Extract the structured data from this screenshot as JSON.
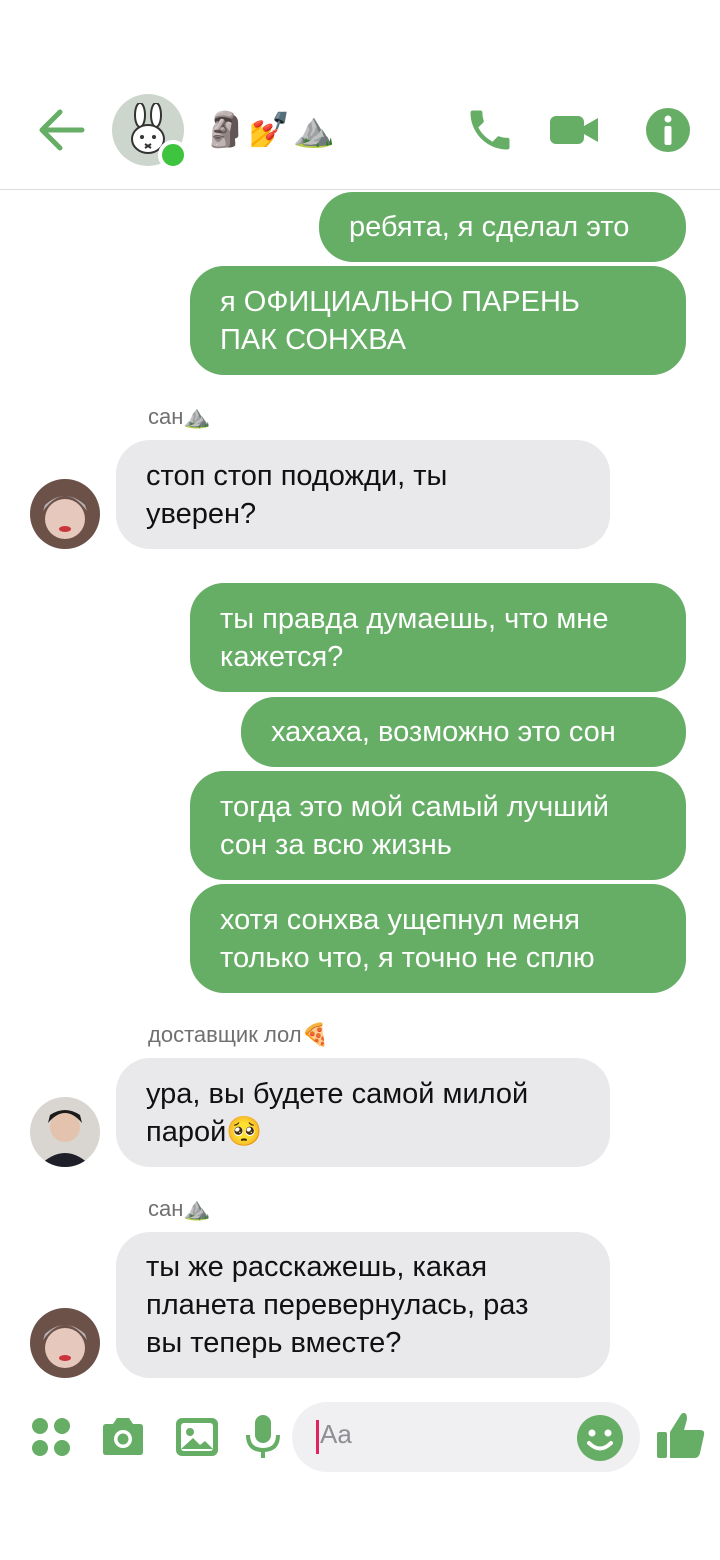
{
  "header": {
    "title": "🗿💅⛰️",
    "icons": [
      "arrow-left-icon",
      "phone-icon",
      "video-camera-icon",
      "info-icon"
    ],
    "accent": "#66ad66"
  },
  "messages": [
    {
      "side": "out",
      "text": "ребята, я сделал это"
    },
    {
      "side": "out",
      "lines": [
        "я ОФИЦИАЛЬНО ПАРЕНЬ",
        "ПАК СОНХВА"
      ]
    },
    {
      "side": "in",
      "sender": "сан⛰️",
      "lines": [
        "стоп стоп подожди, ты",
        "уверен?"
      ]
    },
    {
      "side": "out",
      "lines": [
        "ты правда думаешь, что мне",
        "кажется?"
      ]
    },
    {
      "side": "out",
      "text": "хахаха, возможно это сон"
    },
    {
      "side": "out",
      "lines": [
        "тогда это мой самый лучший",
        "сон за всю жизнь"
      ]
    },
    {
      "side": "out",
      "lines": [
        "хотя сонхва ущепнул меня",
        "только что, я точно не сплю"
      ]
    },
    {
      "side": "in",
      "sender": "доставщик лол🍕",
      "lines": [
        "ура, вы будете самой милой",
        "парой🥺"
      ]
    },
    {
      "side": "in",
      "sender": "сан⛰️",
      "lines": [
        "ты же расскажешь, какая",
        "планета перевернулась, раз",
        "вы теперь вместе?"
      ]
    }
  ],
  "composer": {
    "placeholder": "Aa",
    "icons": [
      "apps-grid-icon",
      "camera-icon",
      "image-icon",
      "microphone-icon",
      "smiley-icon",
      "thumbs-up-icon"
    ]
  },
  "colors": {
    "outgoing": "#66ad66",
    "incoming": "#e9e9eb",
    "online": "#3ec43e"
  }
}
